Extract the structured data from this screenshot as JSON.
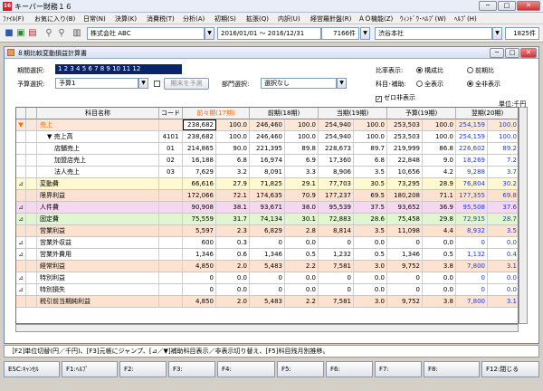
{
  "window": {
    "title": "キーパー財務１６",
    "app_icon": "16",
    "min": "─",
    "max": "□",
    "close": "✕"
  },
  "menubar": [
    "ﾌｧｲﾙ(F)",
    "お気に入り(B)",
    "日常(N)",
    "決算(K)",
    "消費税(T)",
    "分析(A)",
    "初期(S)",
    "拡張(Q)",
    "内訳(U)",
    "経営羅針盤(R)",
    "ＡＯ機能(Z)",
    "ｳｨﾝﾄﾞｳ･ﾍﾙﾌﾟ(W)",
    "ﾍﾙﾌﾟ(H)"
  ],
  "toolbar": {
    "company": "株式会社 ABC",
    "period": "2016/01/01 ～ 2016/12/31",
    "count1": "7166件",
    "office": "渋谷本社",
    "count2": "1825件"
  },
  "doc": {
    "title": "８期比較変動損益計算書",
    "min": "─",
    "max": "□",
    "close": "✕"
  },
  "controls": {
    "period_label": "期間選択:",
    "period_digits": "1 2 3 4 5 6 7 8 9 10 11 12",
    "budget_label": "予算選択:",
    "budget_value": "予算1",
    "apply_button": "期末を予測",
    "dept_label": "部門選択:",
    "dept_value": "選択なし",
    "ratio_label": "比率表示:",
    "ratio_opt1": "構成比",
    "ratio_opt2": "前期比",
    "sub_label": "科目･補助:",
    "sub_opt1": "全表示",
    "sub_opt2": "全非表示",
    "zero_label": "ゼロ非表示",
    "zero_check": "✓",
    "unit": "単位:千円"
  },
  "columns": {
    "name": "科目名称",
    "code": "コード",
    "p17": "前々期(17期)",
    "p18": "前期(18期)",
    "p19": "当期(19期)",
    "b19": "予算(19期)",
    "n20": "翌期(20期)"
  },
  "rows": [
    {
      "mark": "▼",
      "name": "売上",
      "code": "",
      "v": [
        "238,682",
        "100.0",
        "246,460",
        "100.0",
        "254,940",
        "100.0",
        "253,503",
        "100.0",
        "254,159",
        "100.0"
      ],
      "bg": "#fce7d8",
      "ind": 0,
      "hl": true
    },
    {
      "mark": "",
      "name": "▼ 売上高",
      "code": "4101",
      "v": [
        "238,682",
        "100.0",
        "246,460",
        "100.0",
        "254,940",
        "100.0",
        "253,503",
        "100.0",
        "254,159",
        "100.0"
      ],
      "bg": "#ffffff",
      "ind": 1,
      "hl": false
    },
    {
      "mark": "",
      "name": "店舗売上",
      "code": "01",
      "v": [
        "214,865",
        "90.0",
        "221,395",
        "89.8",
        "228,673",
        "89.7",
        "219,999",
        "86.8",
        "226,602",
        "89.2"
      ],
      "bg": "#ffffff",
      "ind": 2,
      "hl": false
    },
    {
      "mark": "",
      "name": "加盟店売上",
      "code": "02",
      "v": [
        "16,188",
        "6.8",
        "16,974",
        "6.9",
        "17,360",
        "6.8",
        "22,848",
        "9.0",
        "18,269",
        "7.2"
      ],
      "bg": "#ffffff",
      "ind": 2,
      "hl": false
    },
    {
      "mark": "",
      "name": "法人売上",
      "code": "03",
      "v": [
        "7,629",
        "3.2",
        "8,091",
        "3.3",
        "8,906",
        "3.5",
        "10,656",
        "4.2",
        "9,288",
        "3.7"
      ],
      "bg": "#ffffff",
      "ind": 2,
      "hl": false
    },
    {
      "mark": "⊿",
      "name": "変動費",
      "code": "",
      "v": [
        "66,616",
        "27.9",
        "71,825",
        "29.1",
        "77,703",
        "30.5",
        "73,295",
        "28.9",
        "76,804",
        "30.2"
      ],
      "bg": "#fff8d0",
      "ind": 0,
      "hl": false
    },
    {
      "mark": "",
      "name": "限界利益",
      "code": "",
      "v": [
        "172,066",
        "72.1",
        "174,635",
        "70.9",
        "177,237",
        "69.5",
        "180,208",
        "71.1",
        "177,355",
        "69.8"
      ],
      "bg": "#fde2d0",
      "ind": 0,
      "hl": false
    },
    {
      "mark": "⊿",
      "name": "人件費",
      "code": "",
      "v": [
        "90,908",
        "38.1",
        "93,671",
        "38.0",
        "95,539",
        "37.5",
        "93,652",
        "36.9",
        "95,508",
        "37.6"
      ],
      "bg": "#f5d8f0",
      "ind": 0,
      "hl": false
    },
    {
      "mark": "⊿",
      "name": "固定費",
      "code": "",
      "v": [
        "75,559",
        "31.7",
        "74,134",
        "30.1",
        "72,883",
        "28.6",
        "75,458",
        "29.8",
        "72,915",
        "28.7"
      ],
      "bg": "#e0f5d0",
      "ind": 0,
      "hl": false
    },
    {
      "mark": "",
      "name": "営業利益",
      "code": "",
      "v": [
        "5,597",
        "2.3",
        "6,829",
        "2.8",
        "8,814",
        "3.5",
        "11,098",
        "4.4",
        "8,932",
        "3.5"
      ],
      "bg": "#fde2d0",
      "ind": 0,
      "hl": false
    },
    {
      "mark": "⊿",
      "name": "営業外収益",
      "code": "",
      "v": [
        "600",
        "0.3",
        "0",
        "0.0",
        "0",
        "0.0",
        "0",
        "0.0",
        "0",
        "0.0"
      ],
      "bg": "#ffffff",
      "ind": 0,
      "hl": false
    },
    {
      "mark": "⊿",
      "name": "営業外費用",
      "code": "",
      "v": [
        "1,346",
        "0.6",
        "1,346",
        "0.5",
        "1,232",
        "0.5",
        "1,346",
        "0.5",
        "1,132",
        "0.4"
      ],
      "bg": "#ffffff",
      "ind": 0,
      "hl": false
    },
    {
      "mark": "",
      "name": "経常利益",
      "code": "",
      "v": [
        "4,850",
        "2.0",
        "5,483",
        "2.2",
        "7,581",
        "3.0",
        "9,752",
        "3.8",
        "7,800",
        "3.1"
      ],
      "bg": "#fde2d0",
      "ind": 0,
      "hl": false
    },
    {
      "mark": "⊿",
      "name": "特別利益",
      "code": "",
      "v": [
        "0",
        "0.0",
        "0",
        "0.0",
        "0",
        "0.0",
        "0",
        "0.0",
        "0",
        "0.0"
      ],
      "bg": "#ffffff",
      "ind": 0,
      "hl": false
    },
    {
      "mark": "⊿",
      "name": "特別損失",
      "code": "",
      "v": [
        "0",
        "0.0",
        "0",
        "0.0",
        "0",
        "0.0",
        "0",
        "0.0",
        "0",
        "0.0"
      ],
      "bg": "#ffffff",
      "ind": 0,
      "hl": false
    },
    {
      "mark": "",
      "name": "税引前当期純利益",
      "code": "",
      "v": [
        "4,850",
        "2.0",
        "5,483",
        "2.2",
        "7,581",
        "3.0",
        "9,752",
        "3.8",
        "7,800",
        "3.1"
      ],
      "bg": "#fde2d0",
      "ind": 0,
      "hl": false
    }
  ],
  "status": "［F2]単位切替(円／千円)、[F3]元帳にジャンプ、[⊿／▼]補助科目表示／非表示切り替え、[F5]科目残月別推移。",
  "fkeys": [
    "ESC:ｷｬﾝｾﾙ",
    "F1:ﾍﾙﾌﾟ",
    "F2:",
    "F3:",
    "F4:",
    "F5:",
    "F6:",
    "F7:",
    "F8:",
    "F12:閉じる"
  ],
  "colors": {
    "accent": "#0a246a",
    "future": "#1f3fd0",
    "negative": "#c00000",
    "orange": "#ff6600"
  }
}
